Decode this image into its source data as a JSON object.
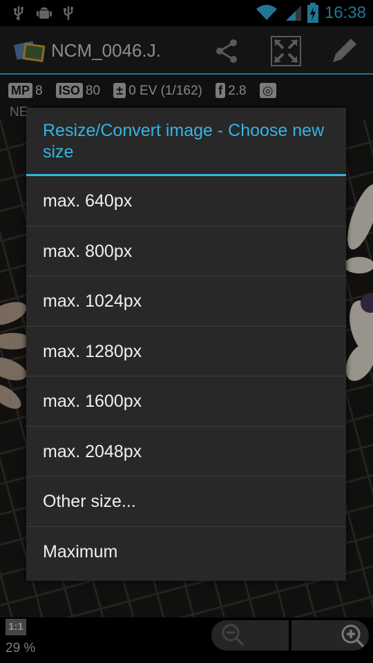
{
  "status_bar": {
    "time": "16:38",
    "icons": [
      "usb-icon",
      "android-debug-icon",
      "usb-icon",
      "wifi-icon",
      "signal-icon",
      "battery-charging-icon"
    ]
  },
  "action_bar": {
    "title": "NCM_0046.J.",
    "icons": [
      "share-icon",
      "fullscreen-icon",
      "edit-icon"
    ]
  },
  "info": {
    "mp_badge": "MP",
    "mp_value": "8",
    "iso_badge": "ISO",
    "iso_value": "80",
    "ev_value": "0 EV (1/162)",
    "aperture_badge": "f",
    "aperture_value": "2.8",
    "row2": "NE"
  },
  "dialog": {
    "title": "Resize/Convert image - Choose new size",
    "items": [
      {
        "label": "max. 640px"
      },
      {
        "label": "max. 800px"
      },
      {
        "label": "max. 1024px"
      },
      {
        "label": "max. 1280px"
      },
      {
        "label": "max. 1600px"
      },
      {
        "label": "max. 2048px"
      },
      {
        "label": "Other size..."
      },
      {
        "label": "Maximum"
      }
    ]
  },
  "bottom_bar": {
    "one_to_one": "1:1",
    "zoom_percent": "29 %"
  },
  "colors": {
    "accent": "#33b5e5",
    "dialog_bg": "#282828"
  }
}
